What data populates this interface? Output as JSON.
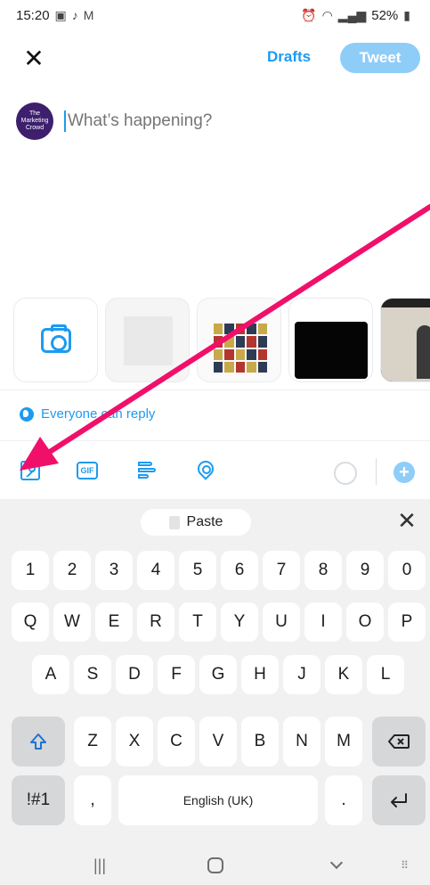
{
  "status_bar": {
    "time": "15:20",
    "battery": "52%",
    "left_icons": [
      "gallery-icon",
      "tiktok-icon",
      "gmail-icon"
    ],
    "right_icons": [
      "alarm-icon",
      "wifi-icon",
      "signal-icon",
      "battery-icon"
    ]
  },
  "header": {
    "drafts_label": "Drafts",
    "tweet_label": "Tweet"
  },
  "compose": {
    "avatar_text": "The Marketing Crowd",
    "placeholder": "What’s happening?"
  },
  "media_strip": {
    "items": [
      "camera",
      "photo-1",
      "photo-2",
      "photo-3",
      "photo-4"
    ]
  },
  "reply_setting": {
    "label": "Everyone can reply"
  },
  "toolbar": {
    "icons": [
      "image-icon",
      "gif-icon",
      "poll-icon",
      "location-icon"
    ],
    "gif_label": "GIF",
    "add_label": "+"
  },
  "keyboard": {
    "paste_label": "Paste",
    "close_label": "✕",
    "row_numbers": [
      "1",
      "2",
      "3",
      "4",
      "5",
      "6",
      "7",
      "8",
      "9",
      "0"
    ],
    "row_top": [
      "Q",
      "W",
      "E",
      "R",
      "T",
      "Y",
      "U",
      "I",
      "O",
      "P"
    ],
    "row_middle": [
      "A",
      "S",
      "D",
      "F",
      "G",
      "H",
      "J",
      "K",
      "L"
    ],
    "row_bottom": [
      "Z",
      "X",
      "C",
      "V",
      "B",
      "N",
      "M"
    ],
    "symbols_label": "!#1",
    "comma_label": ",",
    "space_label": "English (UK)",
    "period_label": ".",
    "shift_icon": "shift-icon",
    "backspace_icon": "backspace-icon",
    "enter_icon": "enter-icon"
  },
  "nav_bar": {
    "recents_label": "|||",
    "keyboard_picker_label": "⠿"
  },
  "colors": {
    "accent": "#1d9bf0",
    "tweet_button_disabled": "#8ecdf8",
    "annotation_arrow": "#f0106a",
    "keyboard_bg": "#f1f1f1"
  }
}
